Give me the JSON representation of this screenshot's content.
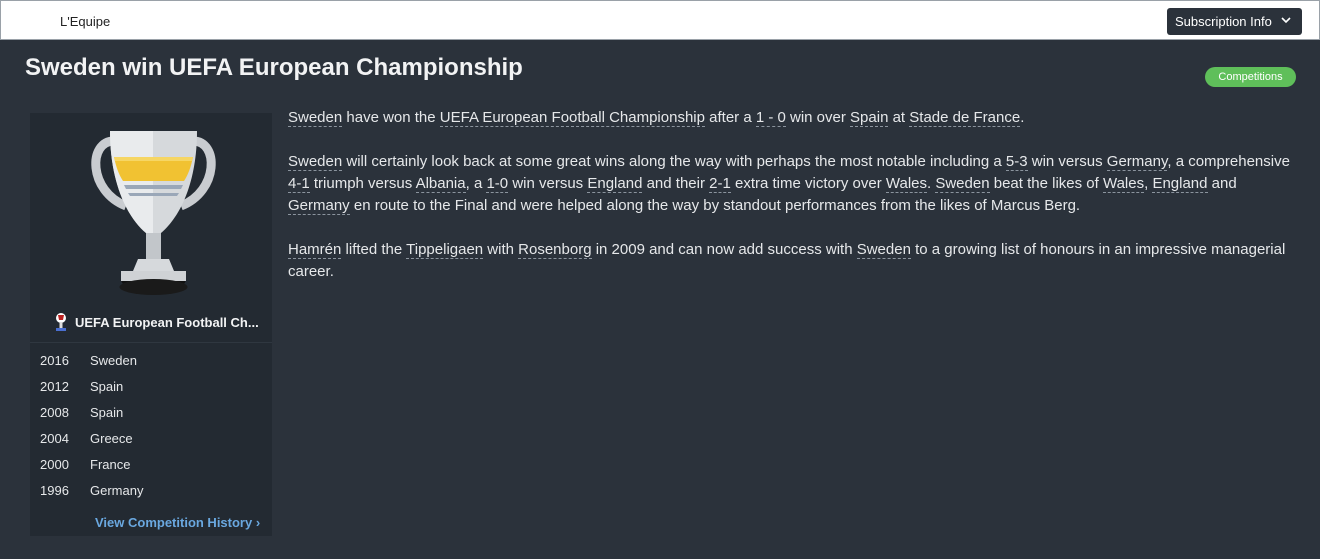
{
  "header": {
    "source": "L'Equipe",
    "subscription_label": "Subscription Info"
  },
  "title": "Sweden win UEFA European Championship",
  "badge": "Competitions",
  "panel": {
    "competition_name": "UEFA European Football Ch...",
    "history": [
      {
        "year": "2016",
        "team": "Sweden"
      },
      {
        "year": "2012",
        "team": "Spain"
      },
      {
        "year": "2008",
        "team": "Spain"
      },
      {
        "year": "2004",
        "team": "Greece"
      },
      {
        "year": "2000",
        "team": "France"
      },
      {
        "year": "1996",
        "team": "Germany"
      }
    ],
    "history_link": "View Competition History"
  },
  "article": {
    "p1": {
      "l_sweden": "Sweden",
      "t1": " have won the ",
      "l_comp": "UEFA European Football Championship",
      "t2": " after a ",
      "l_score": "1 - 0",
      "t3": " win over ",
      "l_spain": "Spain",
      "t4": " at ",
      "l_venue": "Stade de France",
      "t5": "."
    },
    "p2": {
      "l_sweden": "Sweden",
      "t1": " will certainly look back at some great wins along the way with perhaps the most notable including a ",
      "l_s1": "5-3",
      "t2": " win versus ",
      "l_germany": "Germany",
      "t3": ", a comprehensive ",
      "l_s2": "4-1",
      "t4": " triumph versus ",
      "l_albania": "Albania",
      "t5": ", a ",
      "l_s3": "1-0",
      "t6": " win versus ",
      "l_england": "England",
      "t7": " and their ",
      "l_s4": "2-1",
      "t8": " extra time victory over ",
      "l_wales": "Wales",
      "t9": ". ",
      "l_sweden2": "Sweden",
      "t10": " beat the likes of ",
      "l_wales2": "Wales",
      "t11": ", ",
      "l_england2": "England",
      "t12": " and ",
      "l_germany2": "Germany",
      "t13": " en route to the Final and were helped along the way by standout performances from the likes of Marcus Berg."
    },
    "p3": {
      "l_hamren": "Hamrén",
      "t1": " lifted the ",
      "l_league": "Tippeligaen",
      "t2": " with ",
      "l_club": "Rosenborg",
      "t3": " in 2009 and can now add success with ",
      "l_sweden": "Sweden",
      "t4": " to a growing list of honours in an impressive managerial career."
    }
  },
  "colors": {
    "background": "#2b323b",
    "panel": "#232a32",
    "badge": "#5fbf5a",
    "link": "#6aa8e0"
  }
}
